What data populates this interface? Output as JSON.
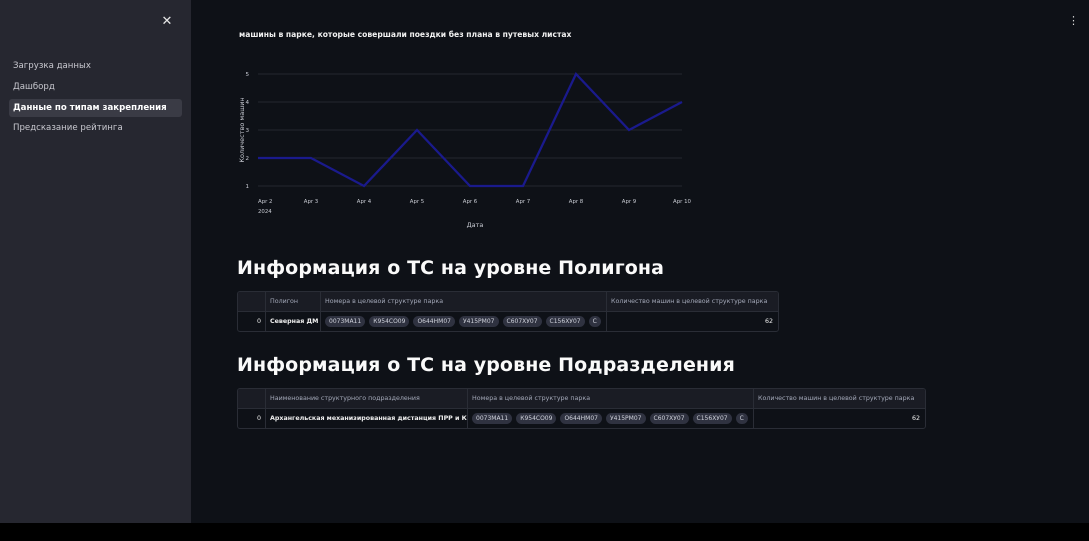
{
  "sidebar": {
    "close_icon": "✕",
    "items": [
      {
        "label": "Загрузка данных"
      },
      {
        "label": "Дашборд"
      },
      {
        "label": "Данные по типам закрепления"
      },
      {
        "label": "Предсказание рейтинга"
      }
    ],
    "active_index": 2
  },
  "main": {
    "menu_icon": "⋮",
    "chart_title": "машины в парке, которые совершали поездки без плана в путевых листах",
    "section1_title": "Информация о ТС на уровне Полигона",
    "section2_title": "Информация о ТС на уровне Подразделения"
  },
  "chart_data": {
    "type": "line",
    "title": "машины в парке, которые совершали поездки без плана в путевых листах",
    "xlabel": "Дата",
    "ylabel": "Количество машин",
    "x": [
      "Apr 2",
      "Apr 3",
      "Apr 4",
      "Apr 5",
      "Apr 6",
      "Apr 7",
      "Apr 8",
      "Apr 9",
      "Apr 10"
    ],
    "x_year_label": "2024",
    "values": [
      2,
      2,
      1,
      3,
      1,
      1,
      5,
      3,
      4
    ],
    "yticks": [
      1,
      2,
      3,
      4,
      5
    ],
    "ylim": [
      1,
      5
    ],
    "grid": true,
    "color": "#1a1a8c"
  },
  "table1": {
    "headers": [
      "",
      "Полигон",
      "Номера в целевой структуре парка",
      "Количество машин в целевой структуре парка"
    ],
    "rows": [
      {
        "index": "0",
        "name": "Северная ДМ",
        "chips": [
          "0073МА11",
          "К954СО09",
          "О644НМ07",
          "У415РМ07",
          "С607ХУ07",
          "С156ХУ07",
          "С"
        ],
        "count": "62"
      }
    ]
  },
  "table2": {
    "headers": [
      "",
      "Наименование структурного подразделения",
      "Номера в целевой структуре парка",
      "Количество машин в целевой структуре парка"
    ],
    "rows": [
      {
        "index": "0",
        "name": "Архангельская механизированная дистанция ПРР и КО",
        "chips": [
          "0073МА11",
          "К954СО09",
          "О644НМ07",
          "У415РМ07",
          "С607ХУ07",
          "С156ХУ07",
          "С"
        ],
        "count": "62"
      }
    ]
  }
}
